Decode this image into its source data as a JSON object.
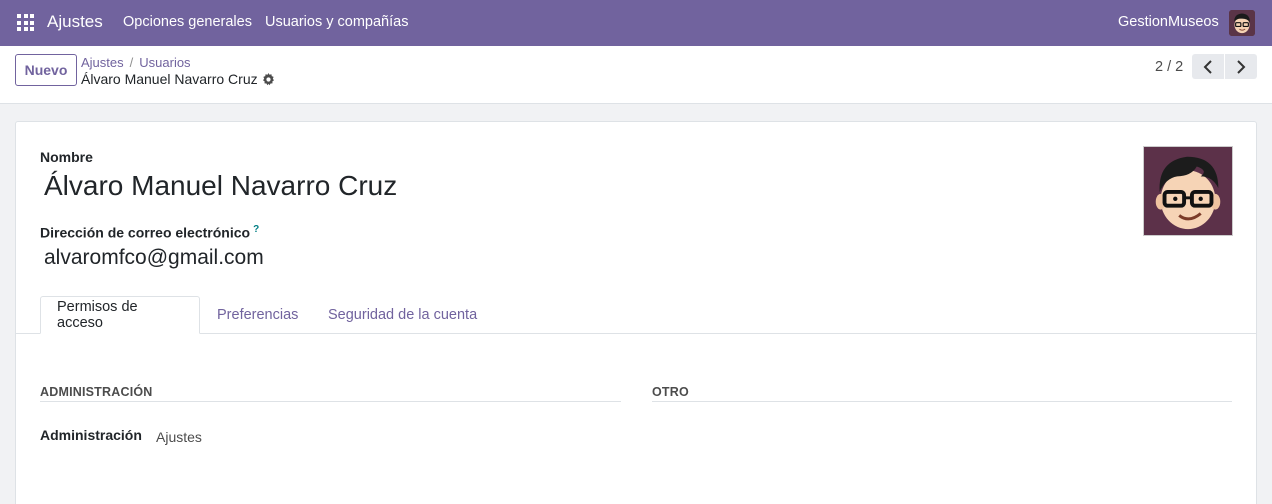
{
  "navbar": {
    "app_name": "Ajustes",
    "menu": [
      "Opciones generales",
      "Usuarios y compañías"
    ],
    "database": "GestionMuseos",
    "bg_color": "#71639e"
  },
  "control_panel": {
    "new_button": "Nuevo",
    "breadcrumb": [
      "Ajustes",
      "Usuarios"
    ],
    "breadcrumb_sep": "/",
    "current_record": "Álvaro Manuel Navarro Cruz",
    "pager": "2 / 2"
  },
  "form": {
    "name_label": "Nombre",
    "name_value": "Álvaro Manuel Navarro Cruz",
    "email_label": "Dirección de correo electrónico",
    "email_help": "?",
    "email_value": "alvaromfco@gmail.com",
    "tabs": [
      "Permisos de acceso",
      "Preferencias",
      "Seguridad de la cuenta"
    ],
    "active_tab": "Permisos de acceso",
    "sections": {
      "admin_title": "ADMINISTRACIÓN",
      "other_title": "OTRO",
      "admin_field_label": "Administración",
      "admin_field_value": "Ajustes"
    }
  },
  "icons": [
    "apps-grid-icon",
    "gear-icon",
    "chevron-left-icon",
    "chevron-right-icon",
    "avatar"
  ]
}
